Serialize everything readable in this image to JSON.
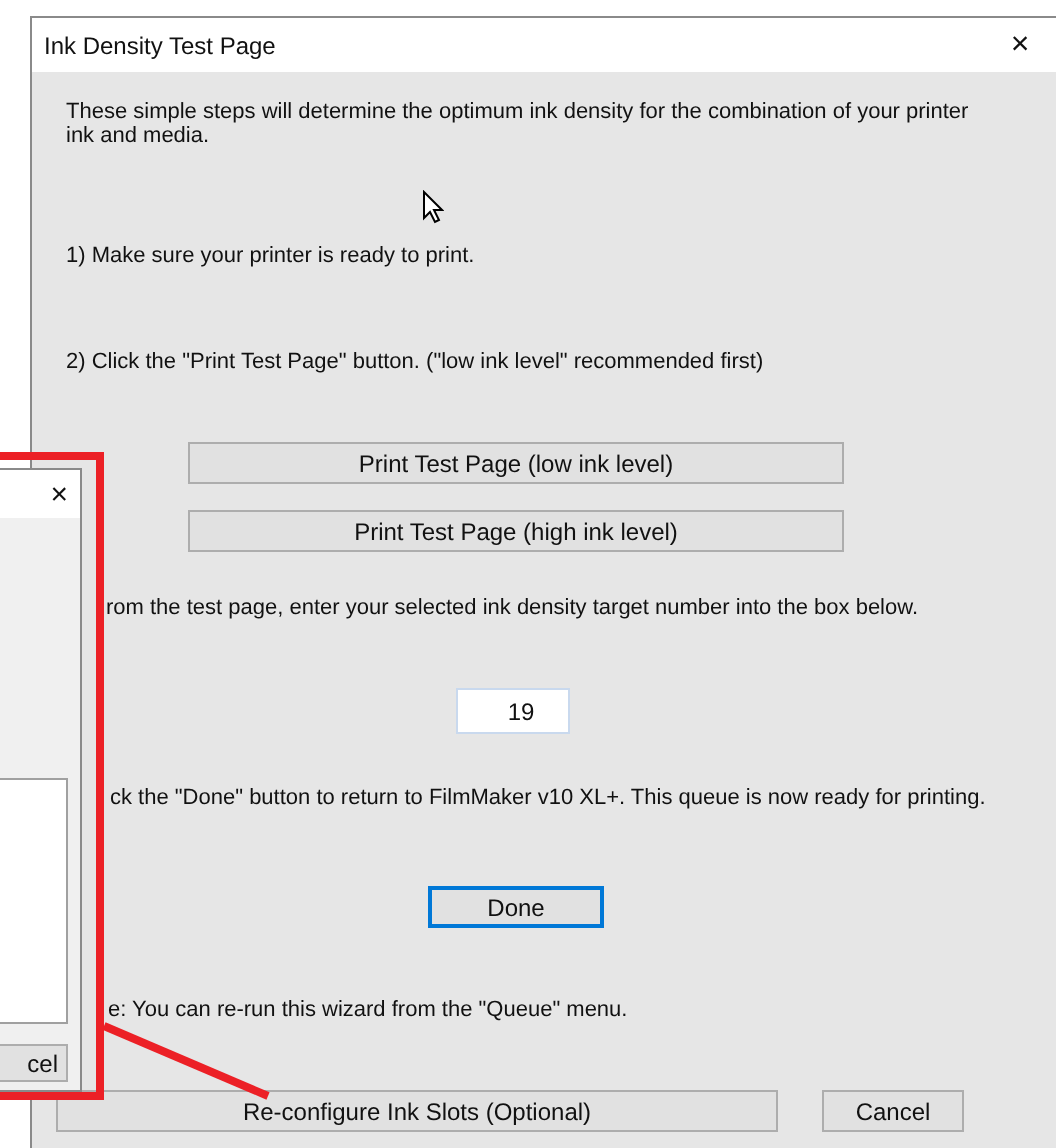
{
  "window": {
    "title": "Ink Density Test Page",
    "close": "×"
  },
  "intro": "These simple steps will determine the optimum ink density for the combination of your printer ink and media.",
  "step_1": "1) Make sure your printer is ready to print.",
  "step_2": "2) Click the \"Print Test Page\" button. (\"low ink level\" recommended first)",
  "print_buttons": [
    "Print Test Page (low ink level)",
    "Print Test Page (high ink level)"
  ],
  "step_3": "rom the test page, enter your selected ink density target number into the box below.",
  "density_field": {
    "value": "19"
  },
  "step_4": "ck the \"Done\" button to return to FilmMaker v10 XL+. This queue is now ready for printing.",
  "done_button": {
    "label": "Done",
    "focused": true
  },
  "note": "e: You can re-run this wizard from the \"Queue\" menu.",
  "footer_buttons": [
    "Re-configure Ink Slots (Optional)",
    "Cancel"
  ],
  "background_dialog": {
    "close": "×",
    "button": "cel"
  }
}
